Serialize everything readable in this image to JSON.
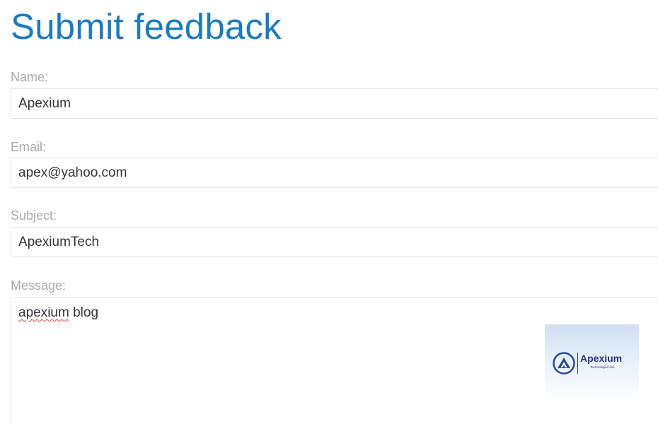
{
  "title": "Submit feedback",
  "form": {
    "name_label": "Name:",
    "name_value": "Apexium",
    "email_label": "Email:",
    "email_value": "apex@yahoo.com",
    "subject_label": "Subject:",
    "subject_value": "ApexiumTech",
    "message_label": "Message:",
    "message_word_misspelled": "apexium",
    "message_rest": " blog"
  },
  "logo": {
    "name": "Apexium",
    "tagline": "Technologies Ltd."
  },
  "colors": {
    "title": "#1b7bc0",
    "label": "#a8a8a8",
    "field_text": "#333333",
    "field_border": "#e3e3e3",
    "spellcheck": "#e04040",
    "logo_brand": "#25357a"
  }
}
